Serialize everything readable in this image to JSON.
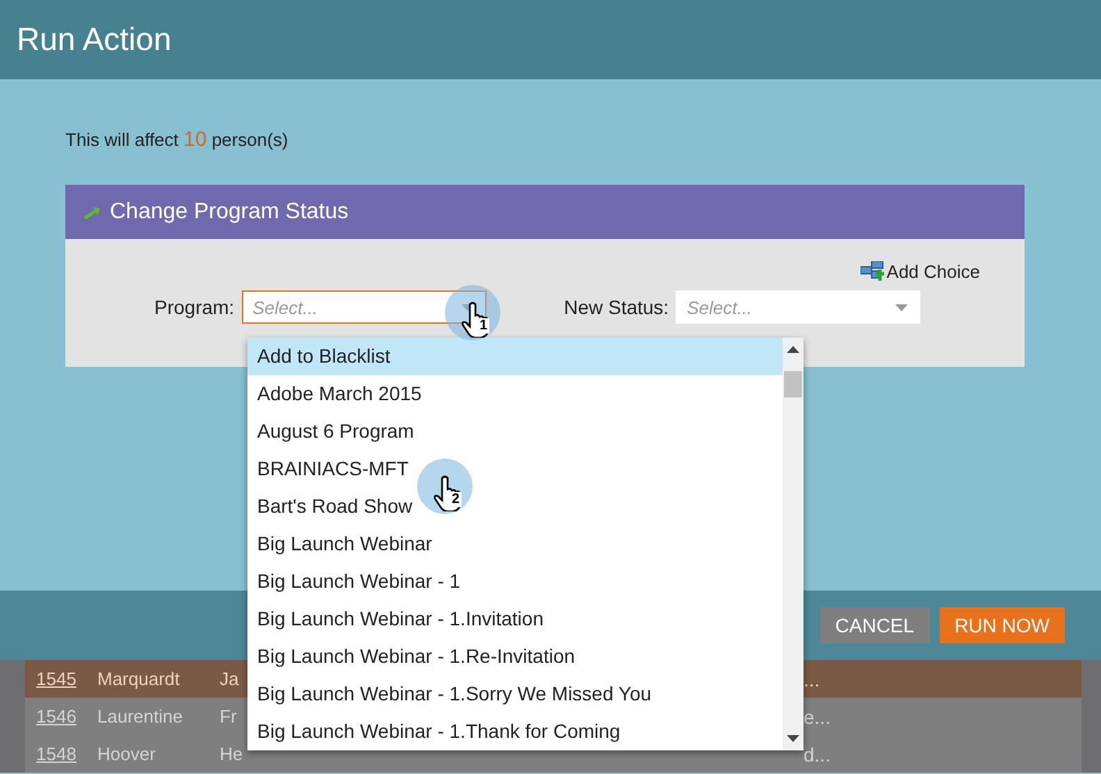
{
  "dialog": {
    "title": "Run Action",
    "affect_prefix": "This will affect",
    "affect_count": "10",
    "affect_suffix": "person(s)"
  },
  "action": {
    "title": "Change Program Status",
    "add_choice": "Add Choice",
    "fields": [
      {
        "label": "Program:",
        "placeholder": "Select...",
        "focused": true
      },
      {
        "label": "New Status:",
        "placeholder": "Select...",
        "focused": false
      }
    ]
  },
  "dropdown": {
    "items": [
      {
        "label": "Add to Blacklist",
        "selected": true
      },
      {
        "label": "Adobe March 2015",
        "selected": false
      },
      {
        "label": "August 6 Program",
        "selected": false
      },
      {
        "label": "BRAINIACS-MFT",
        "selected": false
      },
      {
        "label": "Bart's Road Show",
        "selected": false
      },
      {
        "label": "Big Launch Webinar",
        "selected": false
      },
      {
        "label": "Big Launch Webinar - 1",
        "selected": false
      },
      {
        "label": "Big Launch Webinar - 1.Invitation",
        "selected": false
      },
      {
        "label": "Big Launch Webinar - 1.Re-Invitation",
        "selected": false
      },
      {
        "label": "Big Launch Webinar - 1.Sorry We Missed You",
        "selected": false
      },
      {
        "label": "Big Launch Webinar - 1.Thank for Coming",
        "selected": false
      }
    ]
  },
  "callouts": [
    {
      "label": "1"
    },
    {
      "label": "2"
    }
  ],
  "buttons": [
    {
      "label": "CANCEL",
      "kind": "secondary"
    },
    {
      "label": "RUN NOW",
      "kind": "primary"
    }
  ],
  "background_table": {
    "rows": [
      {
        "id": "1545",
        "name": "Marquardt",
        "first": "Ja",
        "tail": "...",
        "selected": true
      },
      {
        "id": "1546",
        "name": "Laurentine",
        "first": "Fr",
        "tail": "e...",
        "selected": false
      },
      {
        "id": "1548",
        "name": "Hoover",
        "first": "He",
        "tail": "d...",
        "selected": false
      }
    ]
  }
}
